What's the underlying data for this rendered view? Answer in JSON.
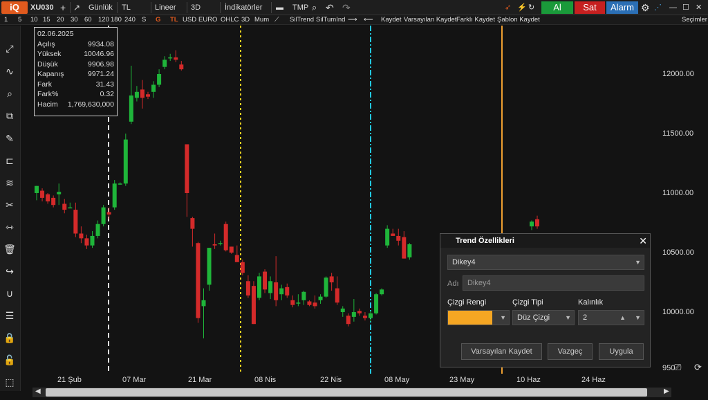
{
  "toolbar": {
    "logo": "iQ",
    "symbol": "XU030",
    "add": "+",
    "period": "Günlük",
    "currency": "TL",
    "scale": "Lineer",
    "mode3d": "3D",
    "indicators": "İndikatörler",
    "tmp": "TMP",
    "buy": "Al",
    "sell": "Sat",
    "alarm": "Alarm"
  },
  "subbar": {
    "intervals": [
      "1",
      "5",
      "10",
      "15",
      "20",
      "30",
      "60",
      "120",
      "180",
      "240",
      "S"
    ],
    "g": "G",
    "tl": "TL",
    "usd": "USD",
    "euro": "EURO",
    "ohlc": "OHLC",
    "d3": "3D",
    "mum": "Mum",
    "siltrend": "SilTrend",
    "siltumind": "SilTumInd",
    "kaydet": "Kaydet",
    "varsayilan": "Varsayılan Kaydet",
    "farkli": "Farklı Kaydet",
    "sablon": "Şablon Kaydet",
    "secimler": "Seçimler"
  },
  "info": {
    "date": "02.06.2025",
    "rows": [
      {
        "label": "Açılış",
        "value": "9934.08"
      },
      {
        "label": "Yüksek",
        "value": "10046.96"
      },
      {
        "label": "Düşük",
        "value": "9906.98"
      },
      {
        "label": "Kapanış",
        "value": "9971.24"
      },
      {
        "label": "Fark",
        "value": "31.43"
      },
      {
        "label": "Fark%",
        "value": "0.32"
      },
      {
        "label": "Hacim",
        "value": "1,769,630,000"
      }
    ]
  },
  "yaxis": [
    "12000.00",
    "11500.00",
    "11000.00",
    "10500.00",
    "10000.00",
    "950"
  ],
  "xaxis": [
    "21 Şub",
    "07 Mar",
    "21 Mar",
    "08 Nis",
    "22 Nis",
    "08 May",
    "23 May",
    "10 Haz",
    "24 Haz"
  ],
  "dialog": {
    "title": "Trend Özellikleri",
    "close": "✕",
    "line_name": "Dikey4",
    "name_label": "Adı",
    "name_value": "Dikey4",
    "color_label": "Çizgi Rengi",
    "type_label": "Çizgi Tipi",
    "type_value": "Düz Çizgi",
    "width_label": "Kalınlık",
    "width_value": "2",
    "color": "#f5a623",
    "btn_default": "Varsayılan Kaydet",
    "btn_cancel": "Vazgeç",
    "btn_apply": "Uygula"
  },
  "colors": {
    "up": "#1fb53a",
    "down": "#d42a2a",
    "vline_orange": "#f0a030",
    "vline_cyan": "#22c8e0",
    "vline_yellow": "#e8d020",
    "vline_white": "#e0e0e0"
  },
  "chart_data": {
    "type": "candlestick",
    "candles": [
      {
        "o": 11000,
        "h": 11050,
        "l": 10940,
        "c": 11060
      },
      {
        "o": 11020,
        "h": 11040,
        "l": 10930,
        "c": 10960
      },
      {
        "o": 10990,
        "h": 11000,
        "l": 10910,
        "c": 10930
      },
      {
        "o": 10960,
        "h": 10980,
        "l": 10880,
        "c": 10900
      },
      {
        "o": 10990,
        "h": 11080,
        "l": 10900,
        "c": 11010
      },
      {
        "o": 10910,
        "h": 10950,
        "l": 10830,
        "c": 10860
      },
      {
        "o": 10880,
        "h": 10920,
        "l": 10880,
        "c": 10880
      },
      {
        "o": 10860,
        "h": 10920,
        "l": 10630,
        "c": 10660
      },
      {
        "o": 10660,
        "h": 10720,
        "l": 10580,
        "c": 10620
      },
      {
        "o": 10620,
        "h": 10650,
        "l": 10530,
        "c": 10560
      },
      {
        "o": 10560,
        "h": 10680,
        "l": 10540,
        "c": 10640
      },
      {
        "o": 10640,
        "h": 10770,
        "l": 10620,
        "c": 10740
      },
      {
        "o": 10740,
        "h": 10900,
        "l": 10720,
        "c": 10880
      },
      {
        "o": 10840,
        "h": 10880,
        "l": 10780,
        "c": 10820
      },
      {
        "o": 10880,
        "h": 11110,
        "l": 10860,
        "c": 11080
      },
      {
        "o": 11080,
        "h": 11090,
        "l": 11070,
        "c": 11080
      },
      {
        "o": 11080,
        "h": 11500,
        "l": 11060,
        "c": 11450
      },
      {
        "o": 11600,
        "h": 12070,
        "l": 11580,
        "c": 11820
      },
      {
        "o": 11800,
        "h": 11900,
        "l": 11770,
        "c": 11850
      },
      {
        "o": 11870,
        "h": 11950,
        "l": 11710,
        "c": 11800
      },
      {
        "o": 11830,
        "h": 11850,
        "l": 11790,
        "c": 11810
      },
      {
        "o": 11850,
        "h": 11940,
        "l": 11800,
        "c": 11910
      },
      {
        "o": 11910,
        "h": 12040,
        "l": 11890,
        "c": 12000
      },
      {
        "o": 12060,
        "h": 12150,
        "l": 12040,
        "c": 12120
      },
      {
        "o": 12140,
        "h": 12170,
        "l": 12110,
        "c": 12140
      },
      {
        "o": 12140,
        "h": 12200,
        "l": 12100,
        "c": 12120
      },
      {
        "o": 12080,
        "h": 12110,
        "l": 12030,
        "c": 12040
      },
      {
        "o": 11410,
        "h": 11400,
        "l": 10800,
        "c": 11000
      },
      {
        "o": 10790,
        "h": 10800,
        "l": 10550,
        "c": 10700
      },
      {
        "o": 10580,
        "h": 10590,
        "l": 9910,
        "c": 9950
      },
      {
        "o": 10050,
        "h": 10200,
        "l": 9780,
        "c": 10100
      },
      {
        "o": 10230,
        "h": 10360,
        "l": 10180,
        "c": 10540
      },
      {
        "o": 10570,
        "h": 10660,
        "l": 10530,
        "c": 10560
      },
      {
        "o": 10580,
        "h": 10600,
        "l": 10560,
        "c": 10580
      },
      {
        "o": 10740,
        "h": 10760,
        "l": 10510,
        "c": 10520
      },
      {
        "o": 10550,
        "h": 10550,
        "l": 10490,
        "c": 10500
      },
      {
        "o": 10480,
        "h": 10560,
        "l": 10430,
        "c": 10420
      },
      {
        "o": 10420,
        "h": 10440,
        "l": 10310,
        "c": 10330
      },
      {
        "o": 10260,
        "h": 10310,
        "l": 10120,
        "c": 10140
      },
      {
        "o": 10220,
        "h": 10260,
        "l": 9900,
        "c": 9900
      },
      {
        "o": 10120,
        "h": 10330,
        "l": 10100,
        "c": 10300
      },
      {
        "o": 10340,
        "h": 10360,
        "l": 10160,
        "c": 10190
      },
      {
        "o": 10160,
        "h": 10300,
        "l": 10110,
        "c": 10260
      },
      {
        "o": 10250,
        "h": 10470,
        "l": 10050,
        "c": 10100
      },
      {
        "o": 10150,
        "h": 10230,
        "l": 10100,
        "c": 10200
      },
      {
        "o": 10210,
        "h": 10240,
        "l": 10120,
        "c": 10140
      },
      {
        "o": 10100,
        "h": 10140,
        "l": 10040,
        "c": 10060
      },
      {
        "o": 10080,
        "h": 10150,
        "l": 10050,
        "c": 10080
      },
      {
        "o": 10100,
        "h": 10180,
        "l": 10060,
        "c": 10170
      },
      {
        "o": 10090,
        "h": 10100,
        "l": 10050,
        "c": 10060
      },
      {
        "o": 10080,
        "h": 10140,
        "l": 10030,
        "c": 10050
      },
      {
        "o": 10100,
        "h": 10150,
        "l": 10070,
        "c": 10130
      },
      {
        "o": 10130,
        "h": 10300,
        "l": 10120,
        "c": 10290
      },
      {
        "o": 10300,
        "h": 10330,
        "l": 10180,
        "c": 10250
      },
      {
        "o": 10200,
        "h": 10300,
        "l": 10060,
        "c": 10080
      },
      {
        "o": 10000,
        "h": 10050,
        "l": 9960,
        "c": 10030
      },
      {
        "o": 9970,
        "h": 9990,
        "l": 9880,
        "c": 9900
      },
      {
        "o": 9960,
        "h": 10110,
        "l": 9920,
        "c": 10000
      },
      {
        "o": 10010,
        "h": 10030,
        "l": 9970,
        "c": 9990
      },
      {
        "o": 9970,
        "h": 10000,
        "l": 9930,
        "c": 9950
      },
      {
        "o": 9950,
        "h": 10010,
        "l": 9920,
        "c": 9990
      },
      {
        "o": 9990,
        "h": 10160,
        "l": 9980,
        "c": 10150
      },
      {
        "o": 10150,
        "h": 10200,
        "l": 10140,
        "c": 10190
      },
      {
        "o": 10560,
        "h": 10730,
        "l": 10540,
        "c": 10700
      },
      {
        "o": 10660,
        "h": 10700,
        "l": 10640,
        "c": 10640
      },
      {
        "o": 10640,
        "h": 10700,
        "l": 10560,
        "c": 10600
      },
      {
        "o": 10630,
        "h": 10680,
        "l": 10450,
        "c": 10450
      },
      {
        "o": 10460,
        "h": 10580,
        "l": 10440,
        "c": 10570
      }
    ],
    "candles_right": [
      {
        "o": 10720,
        "h": 10770,
        "l": 10690,
        "c": 10760
      },
      {
        "o": 10780,
        "h": 10810,
        "l": 10700,
        "c": 10720
      }
    ],
    "ylim": [
      9400,
      12600
    ]
  }
}
